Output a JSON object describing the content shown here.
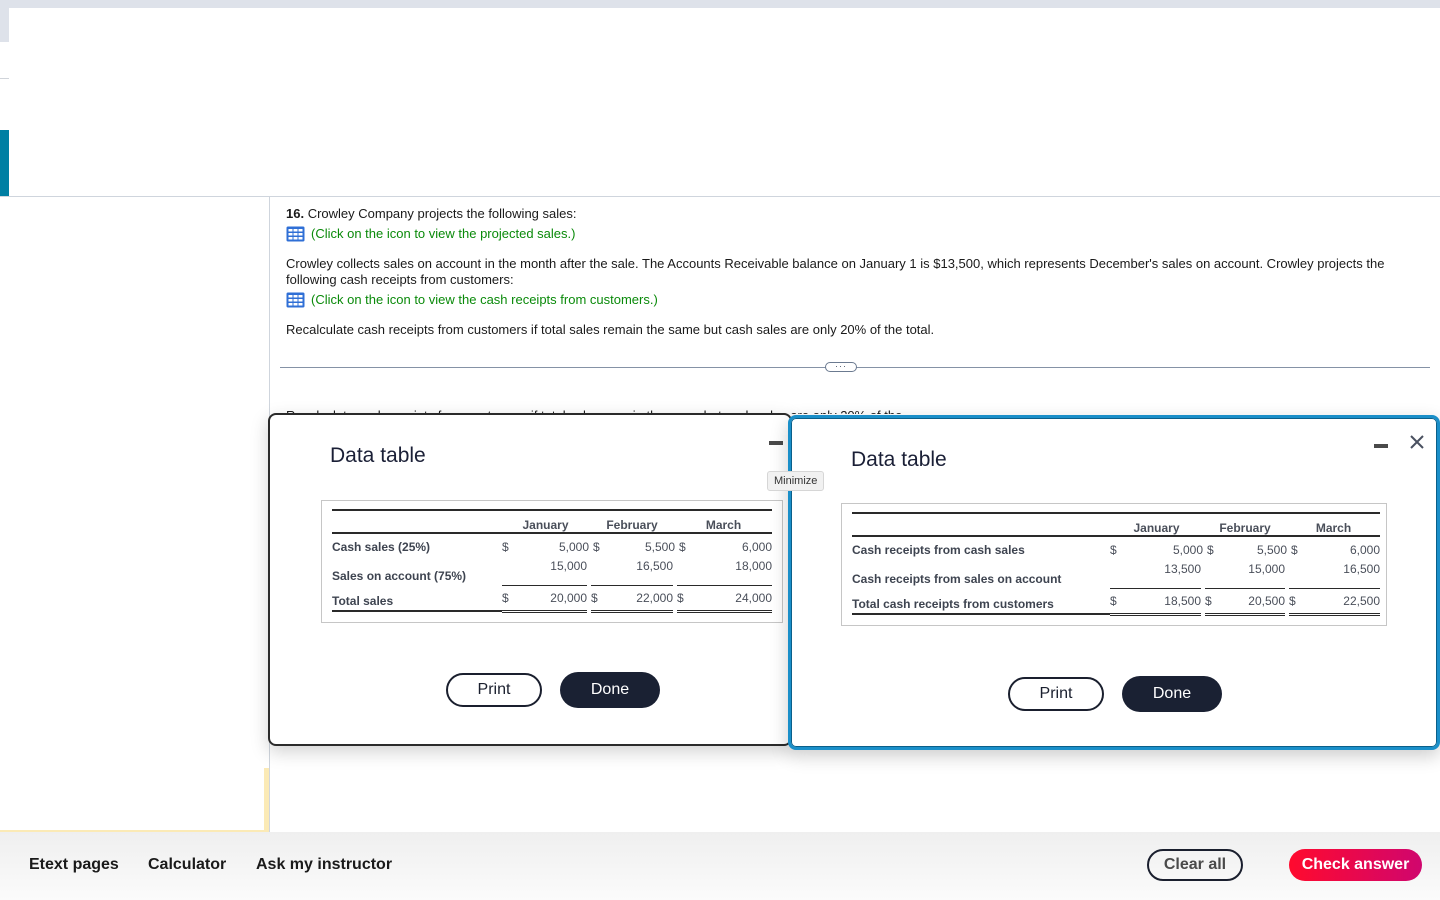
{
  "question": {
    "number": "16.",
    "intro": " Crowley Company projects the following sales:",
    "link_projected_sales": "(Click on the icon to view the projected sales.)",
    "paragraph": "Crowley collects sales on account in the month after the sale. The Accounts Receivable balance on January 1 is $13,500, which represents December's sales on account. Crowley projects the following cash receipts from customers:",
    "link_cash_receipts": "(Click on the icon to view the cash receipts from customers.)",
    "recalculate": "Recalculate cash receipts from customers if total sales remain the same but cash sales are only 20% of the total.",
    "obscured_text": "Recalculate cash receipts from customers if total sales remain the same but cash sales are only 20% of the total.",
    "expander_label": "···"
  },
  "colors": {
    "link_green": "#0a8a0a",
    "accent_blue": "#007fa3",
    "dialog_focus_border": "#1a8fc9",
    "done_button": "#1a2133",
    "check_answer_start": "#ff0a2e",
    "check_answer_end": "#d0066e"
  },
  "dialog_sales": {
    "title": "Data table",
    "minimize_tooltip": "Minimize",
    "columns": [
      "January",
      "February",
      "March"
    ],
    "rows": [
      {
        "label": "Cash sales (25%)",
        "dollar": [
          "$",
          "$",
          "$"
        ],
        "values": [
          "5,000",
          "5,500",
          "6,000"
        ]
      },
      {
        "label": "Sales on account (75%)",
        "dollar": [
          "",
          "",
          ""
        ],
        "values": [
          "15,000",
          "16,500",
          "18,000"
        ]
      },
      {
        "label": "Total sales",
        "dollar": [
          "$",
          "$",
          "$"
        ],
        "values": [
          "20,000",
          "22,000",
          "24,000"
        ]
      }
    ],
    "print_label": "Print",
    "done_label": "Done"
  },
  "dialog_receipts": {
    "title": "Data table",
    "columns": [
      "January",
      "February",
      "March"
    ],
    "rows": [
      {
        "label": "Cash receipts from cash sales",
        "dollar": [
          "$",
          "$",
          "$"
        ],
        "values": [
          "5,000",
          "5,500",
          "6,000"
        ]
      },
      {
        "label": "Cash receipts from sales on account",
        "dollar": [
          "",
          "",
          ""
        ],
        "values": [
          "13,500",
          "15,000",
          "16,500"
        ]
      },
      {
        "label": "Total cash receipts from customers",
        "dollar": [
          "$",
          "$",
          "$"
        ],
        "values": [
          "18,500",
          "20,500",
          "22,500"
        ]
      }
    ],
    "print_label": "Print",
    "done_label": "Done"
  },
  "footer": {
    "etext": "Etext pages",
    "calculator": "Calculator",
    "ask_instructor": "Ask my instructor",
    "clear_all": "Clear all",
    "check_answer": "Check answer"
  }
}
